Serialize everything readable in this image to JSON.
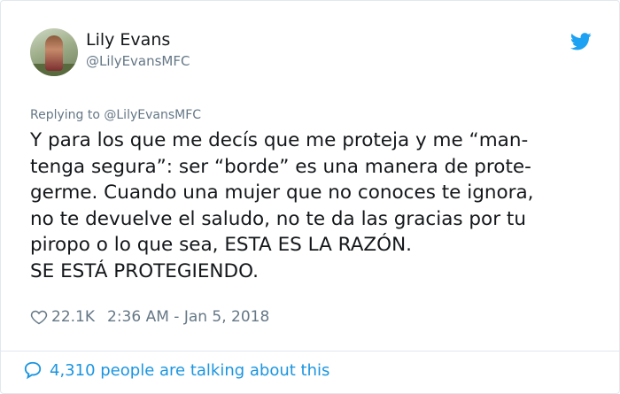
{
  "user": {
    "name": "Lily Evans",
    "handle": "@LilyEvansMFC"
  },
  "reply": {
    "text": "Replying to @LilyEvansMFC"
  },
  "tweet": {
    "lines": [
      "Y para los que me decís que me proteja y me “man-",
      "tenga segura”: ser “borde” es una manera de prote-",
      "germe. Cuando una mujer que no conoces te ignora,",
      "no te devuelve el saludo, no te da las gracias por tu",
      "piropo o lo que sea, ESTA ES LA RAZÓN.",
      "SE ESTÁ PROTEGIENDO."
    ]
  },
  "meta": {
    "likes": "22.1K",
    "timestamp": "2:36 AM - Jan 5, 2018"
  },
  "footer": {
    "talking": "4,310 people are talking about this"
  },
  "icons": {
    "brand": "twitter-bird-icon",
    "like": "heart-icon",
    "comment": "speech-bubble-icon"
  },
  "colors": {
    "brand_blue": "#1da1f2",
    "link_blue": "#1b95e0",
    "secondary_text": "#657786",
    "border": "#e1e8ed"
  }
}
